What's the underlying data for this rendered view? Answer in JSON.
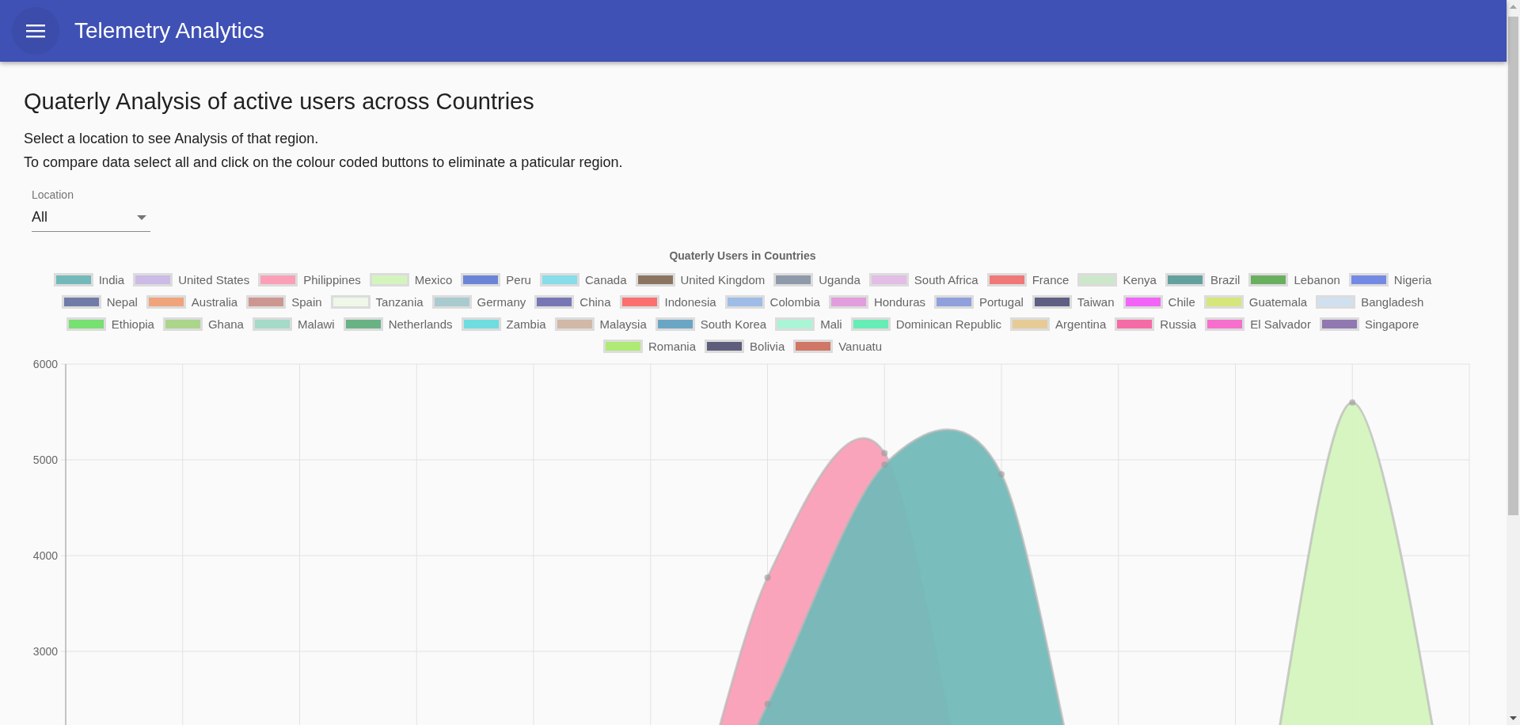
{
  "app_bar": {
    "title": "Telemetry Analytics"
  },
  "heading": "Quaterly Analysis of active users across Countries",
  "instructions": [
    "Select a location to see Analysis of that region.",
    "To compare data select all and click on the colour coded buttons to eliminate a paticular region."
  ],
  "location_select": {
    "label": "Location",
    "value": "All"
  },
  "chart": {
    "chart_data": {
      "type": "area",
      "title": "Quaterly Users in Countries",
      "ylim": [
        0,
        6000
      ],
      "yticks": [
        3000,
        4000,
        5000,
        6000
      ],
      "grid": true,
      "series": [
        {
          "name": "India",
          "color": "#73b9b9",
          "values": [
            0,
            0,
            0,
            0,
            0,
            0,
            2450,
            4950,
            4850,
            0,
            0,
            0,
            0
          ]
        },
        {
          "name": "United States",
          "color": "#cbbbe6"
        },
        {
          "name": "Philippines",
          "color": "#fa9fb7",
          "values": [
            0,
            0,
            0,
            0,
            0,
            0,
            3770,
            5070,
            0,
            0,
            0,
            0,
            0
          ]
        },
        {
          "name": "Mexico",
          "color": "#d4f4bd",
          "values": [
            0,
            0,
            0,
            0,
            0,
            0,
            0,
            0,
            0,
            0,
            0,
            5600,
            0
          ]
        },
        {
          "name": "Peru",
          "color": "#6b84d6"
        },
        {
          "name": "Canada",
          "color": "#87dde9"
        },
        {
          "name": "United Kingdom",
          "color": "#8c7560"
        },
        {
          "name": "Uganda",
          "color": "#8e99aa"
        },
        {
          "name": "South Africa",
          "color": "#e2bde6"
        },
        {
          "name": "France",
          "color": "#f07878"
        },
        {
          "name": "Kenya",
          "color": "#cce7ca"
        },
        {
          "name": "Brazil",
          "color": "#64a09d"
        },
        {
          "name": "Lebanon",
          "color": "#6aaf60"
        },
        {
          "name": "Nigeria",
          "color": "#7489e3"
        },
        {
          "name": "Nepal",
          "color": "#717ba8"
        },
        {
          "name": "Australia",
          "color": "#f0a47b"
        },
        {
          "name": "Spain",
          "color": "#cc9790"
        },
        {
          "name": "Tanzania",
          "color": "#eef7e8"
        },
        {
          "name": "Germany",
          "color": "#a9cbcf"
        },
        {
          "name": "China",
          "color": "#7777b6"
        },
        {
          "name": "Indonesia",
          "color": "#fb6f6f"
        },
        {
          "name": "Colombia",
          "color": "#9ebce6"
        },
        {
          "name": "Honduras",
          "color": "#e29ddc"
        },
        {
          "name": "Portugal",
          "color": "#90a0dc"
        },
        {
          "name": "Taiwan",
          "color": "#5f5f84"
        },
        {
          "name": "Chile",
          "color": "#f264f7"
        },
        {
          "name": "Guatemala",
          "color": "#d6e67a"
        },
        {
          "name": "Bangladesh",
          "color": "#d0e0f0"
        },
        {
          "name": "Ethiopia",
          "color": "#76e070"
        },
        {
          "name": "Ghana",
          "color": "#acd58c"
        },
        {
          "name": "Malawi",
          "color": "#a5d9c8"
        },
        {
          "name": "Netherlands",
          "color": "#68b284"
        },
        {
          "name": "Zambia",
          "color": "#6fdde0"
        },
        {
          "name": "Malaysia",
          "color": "#d1b8a7"
        },
        {
          "name": "South Korea",
          "color": "#6aa6c4"
        },
        {
          "name": "Mali",
          "color": "#a9f5d5"
        },
        {
          "name": "Dominican Republic",
          "color": "#66edb6"
        },
        {
          "name": "Argentina",
          "color": "#e7cb97"
        },
        {
          "name": "Russia",
          "color": "#f56ba6"
        },
        {
          "name": "El Salvador",
          "color": "#f66fcd"
        },
        {
          "name": "Singapore",
          "color": "#9078b0"
        },
        {
          "name": "Romania",
          "color": "#aeea74"
        },
        {
          "name": "Bolivia",
          "color": "#5e5d7c"
        },
        {
          "name": "Vanuatu",
          "color": "#d07767"
        }
      ]
    }
  }
}
